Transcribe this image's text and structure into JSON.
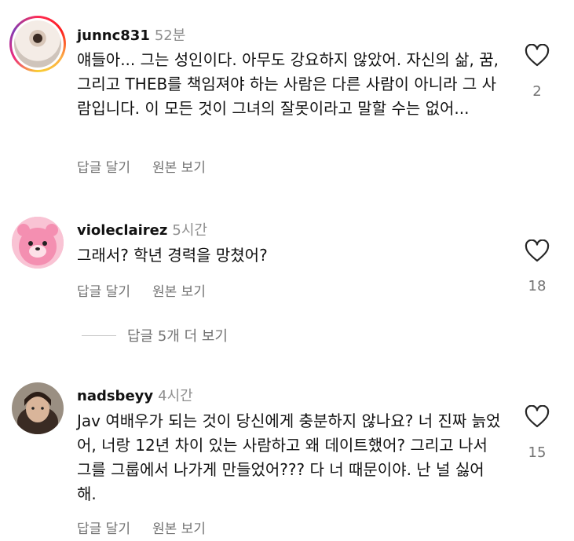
{
  "comments": [
    {
      "username": "junnc831",
      "time": "52분",
      "text": "얘들아... 그는 성인이다. 아무도 강요하지 않았어. 자신의 삶, 꿈, 그리고 THEB를 책임져야 하는 사람은 다른 사람이 아니라 그 사람입니다. 이 모든 것이 그녀의 잘못이라고 말할 수는 없어...",
      "reply": "답글 달기",
      "original": "원본 보기",
      "likes": "2",
      "like_icon": "heart-outline-icon"
    },
    {
      "username": "violeclairez",
      "time": "5시간",
      "text": "그래서? 학년 경력을 망쳤어?",
      "reply": "답글 달기",
      "original": "원본 보기",
      "likes": "18",
      "like_icon": "heart-outline-icon"
    },
    {
      "username": "nadsbeyy",
      "time": "4시간",
      "text": "Jav 여배우가 되는 것이 당신에게 충분하지 않나요? 너 진짜 늙었어, 너랑 12년 차이 있는 사람하고 왜 데이트했어? 그리고 나서 그를 그룹에서 나가게 만들었어??? 다 너 때문이야. 난 널 싫어해.",
      "reply": "답글 달기",
      "original": "원본 보기",
      "likes": "15",
      "like_icon": "heart-outline-icon"
    }
  ],
  "view_replies": "답글 5개 더 보기"
}
